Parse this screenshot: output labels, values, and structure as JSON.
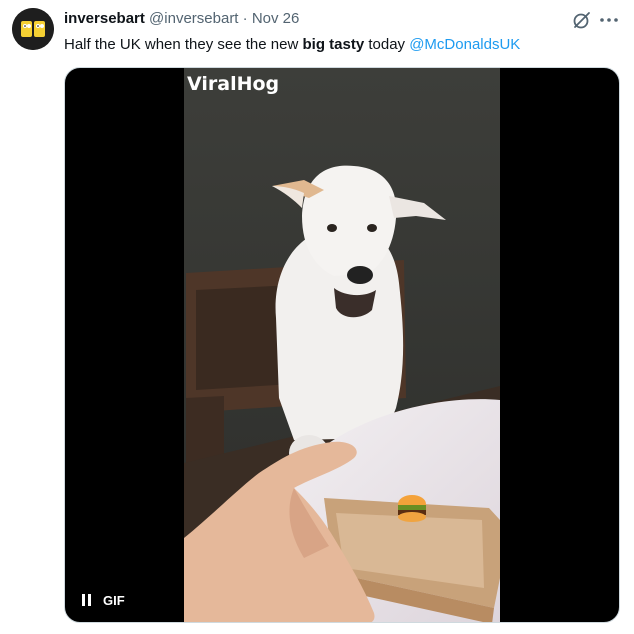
{
  "tweet": {
    "author_name": "inversebart",
    "author_handle": "@inversebart",
    "separator": "·",
    "timestamp": "Nov 26",
    "text_before": "Half the UK when they see the new ",
    "text_bold": "big tasty",
    "text_after": " today ",
    "mention": "@McDonaldsUK"
  },
  "media": {
    "watermark": "ViralHog",
    "badge_label": "GIF",
    "playback_icon": "pause-icon"
  },
  "icons": {
    "grok": "grok-slash-icon",
    "more": "more-horizontal-icon"
  },
  "colors": {
    "link": "#1d9bf0",
    "secondary_text": "#536471",
    "primary_text": "#0f1419"
  }
}
